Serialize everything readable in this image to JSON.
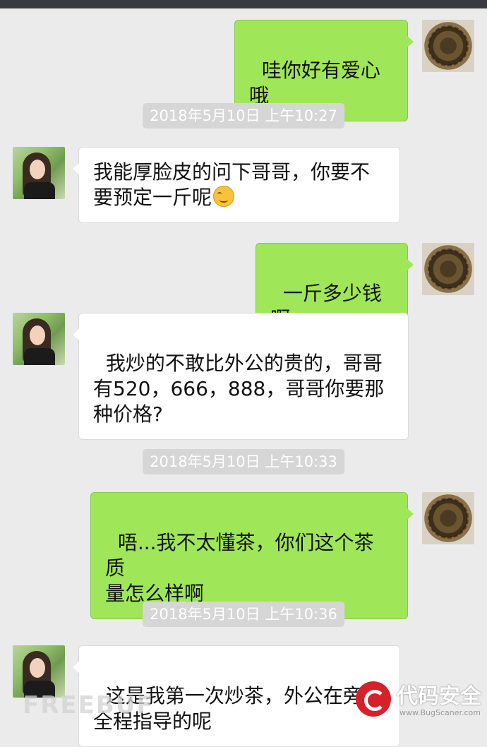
{
  "messages": [
    {
      "side": "sent",
      "text": "哇你好有爱心哦"
    },
    {
      "timestamp": "2018年5月10日 上午10:27"
    },
    {
      "side": "recv",
      "text": "我能厚脸皮的问下哥哥，你要不\n要预定一斤呢",
      "emoji": "smiling-face-emoji"
    },
    {
      "side": "sent",
      "text": "一斤多少钱啊"
    },
    {
      "side": "recv",
      "text": "我炒的不敢比外公的贵的，哥哥\n有520，666，888，哥哥你要那\n种价格?"
    },
    {
      "timestamp": "2018年5月10日 上午10:33"
    },
    {
      "side": "sent",
      "text": "唔...我不太懂茶，你们这个茶质\n量怎么样啊"
    },
    {
      "timestamp": "2018年5月10日 上午10:36"
    },
    {
      "side": "recv",
      "text": "这是我第一次炒茶，外公在旁边\n全程指导的呢"
    }
  ],
  "watermarks": {
    "left_text": "FREEBUF",
    "right_title": "代码安全",
    "right_url": "www.BugScaner.com"
  },
  "colors": {
    "background": "#ebebeb",
    "sent_bubble": "#9fe658",
    "recv_bubble": "#ffffff",
    "timestamp_bg": "#d6d6d6"
  }
}
